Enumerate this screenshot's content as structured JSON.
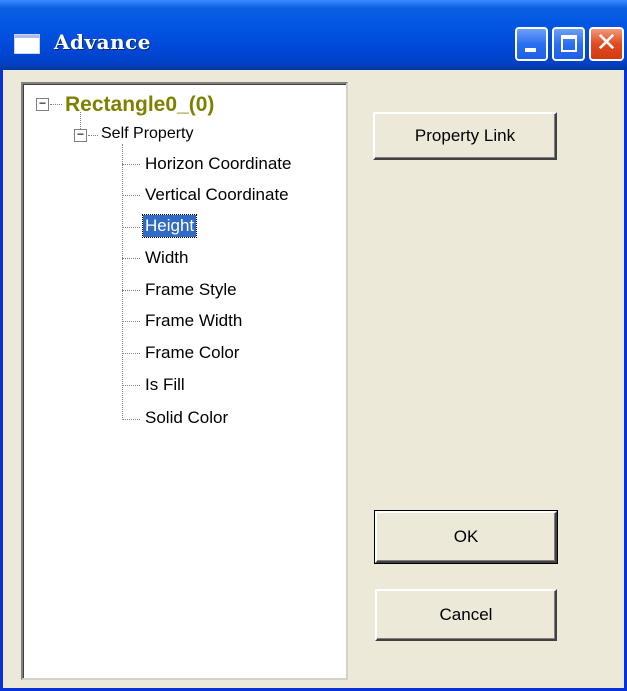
{
  "window": {
    "title": "Advance",
    "title_icon": "window-icon",
    "controls": {
      "minimize_icon": "minimize-icon",
      "maximize_icon": "maximize-icon",
      "close_glyph": "✕"
    }
  },
  "tree": {
    "root": {
      "label": "Rectangle0_(0)",
      "expanded": true,
      "expander": "−"
    },
    "child": {
      "label": "Self Property",
      "expanded": true,
      "expander": "−"
    },
    "leaves": [
      "Horizon Coordinate",
      "Vertical Coordinate",
      "Height",
      "Width",
      "Frame Style",
      "Frame Width",
      "Frame Color",
      "Is Fill",
      "Solid Color"
    ],
    "selected": "Height"
  },
  "buttons": {
    "property_link": "Property Link",
    "ok": "OK",
    "cancel": "Cancel"
  },
  "colors": {
    "titlebar": "#0054e3",
    "root_label": "#808000",
    "selection": "#316ac5",
    "dialog_bg": "#ece9d8"
  }
}
